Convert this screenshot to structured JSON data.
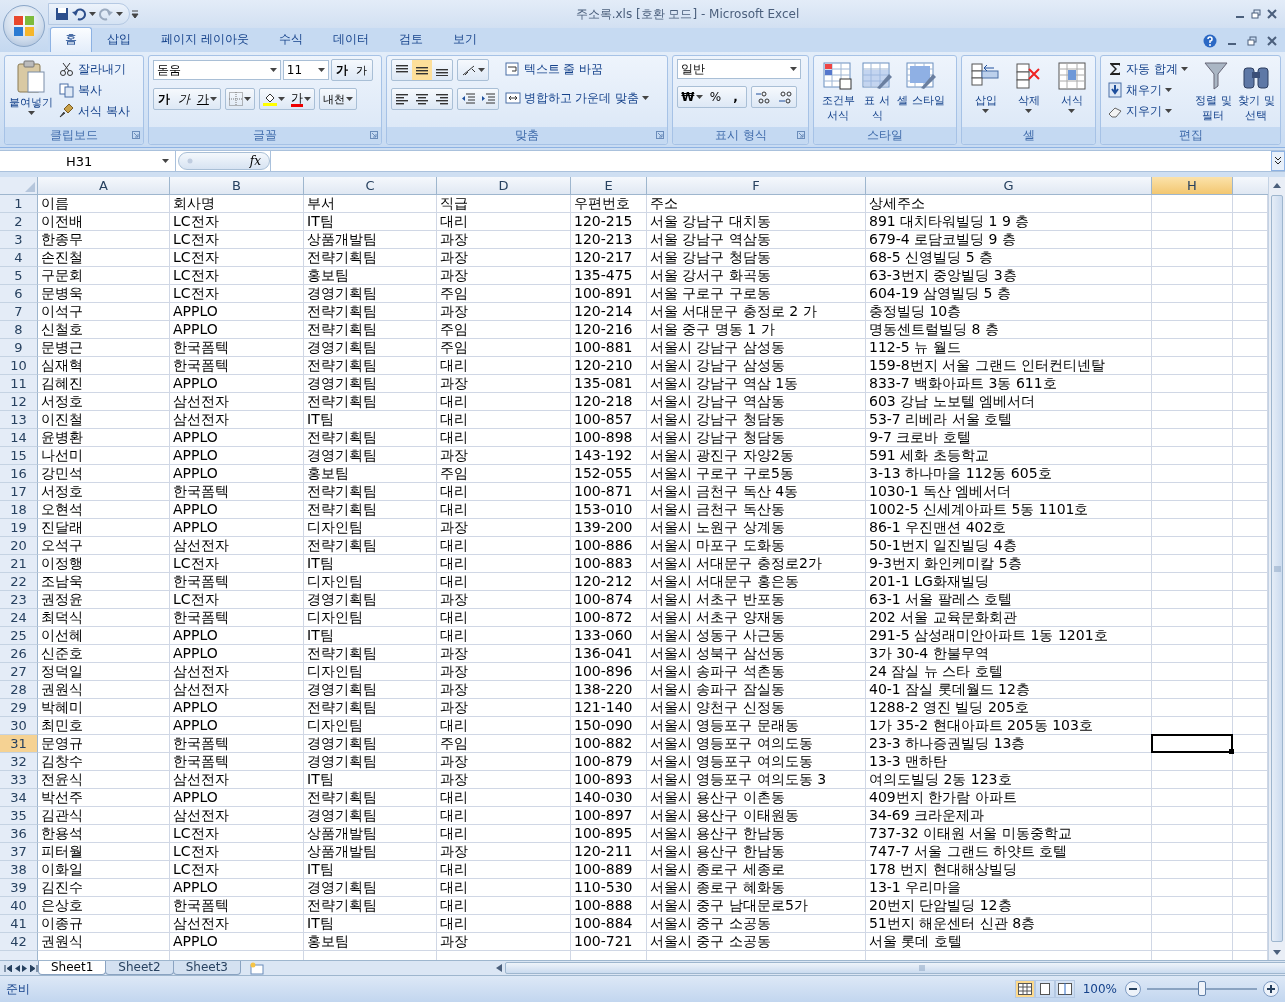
{
  "window": {
    "title": "주소록.xls  [호환 모드] - Microsoft Excel"
  },
  "ribbon": {
    "tabs": [
      {
        "label": "홈",
        "selected": true
      },
      {
        "label": "삽입",
        "selected": false
      },
      {
        "label": "페이지 레이아웃",
        "selected": false
      },
      {
        "label": "수식",
        "selected": false
      },
      {
        "label": "데이터",
        "selected": false
      },
      {
        "label": "검토",
        "selected": false
      },
      {
        "label": "보기",
        "selected": false
      }
    ],
    "groups": [
      {
        "kind": "clipboard",
        "label": "클립보드",
        "paste": "붙여넣기",
        "commands": [
          "잘라내기",
          "복사",
          "서식 복사"
        ]
      },
      {
        "kind": "font",
        "label": "글꼴",
        "font": "돋움",
        "size": "11",
        "grow": "가",
        "shrink": "가",
        "bold": "가",
        "italic": "가",
        "underline": "가",
        "font_color": "가",
        "phonetic": "내천"
      },
      {
        "kind": "alignment",
        "label": "맞춤",
        "wrap": "텍스트 줄 바꿈",
        "merge": "병합하고 가운데 맞춤"
      },
      {
        "kind": "number",
        "label": "표시 형식",
        "format": "일반",
        "currency": "₩",
        "percent": "%",
        "comma": ","
      },
      {
        "kind": "styles",
        "label": "스타일",
        "commands": [
          "조건부 서식",
          "표 서식",
          "셀 스타일"
        ]
      },
      {
        "kind": "cells",
        "label": "셀",
        "commands": [
          "삽입",
          "삭제",
          "서식"
        ]
      },
      {
        "kind": "editing",
        "label": "편집",
        "commands": [
          "자동 합계",
          "채우기",
          "지우기"
        ],
        "large": [
          "정렬 및 필터",
          "찾기 및 선택"
        ]
      }
    ]
  },
  "formula_bar": {
    "name_box": "H31",
    "fx": "fx"
  },
  "sheet": {
    "columns": [
      {
        "label": "A",
        "selected": false
      },
      {
        "label": "B",
        "selected": false
      },
      {
        "label": "C",
        "selected": false
      },
      {
        "label": "D",
        "selected": false
      },
      {
        "label": "E",
        "selected": false
      },
      {
        "label": "F",
        "selected": false
      },
      {
        "label": "G",
        "selected": false
      },
      {
        "label": "H",
        "selected": true
      }
    ],
    "rows": [
      {
        "number": "1",
        "selected": false,
        "cells": [
          "이름",
          "회사명",
          "부서",
          "직급",
          "우편번호",
          "주소",
          "상세주소"
        ]
      },
      {
        "number": "2",
        "selected": false,
        "cells": [
          "이전배",
          "LC전자",
          "IT팀",
          "대리",
          "120-215",
          "서울 강남구 대치동",
          "891 대치타워빌딩 1 9 층"
        ]
      },
      {
        "number": "3",
        "selected": false,
        "cells": [
          "한종무",
          "LC전자",
          "상품개발팀",
          "과장",
          "120-213",
          "서울 강남구 역삼동",
          "679-4 로담코빌딩 9 층"
        ]
      },
      {
        "number": "4",
        "selected": false,
        "cells": [
          "손진철",
          "LC전자",
          "전략기획팀",
          "과장",
          "120-217",
          "서울 강남구 청담동",
          "68-5 신영빌딩 5 층"
        ]
      },
      {
        "number": "5",
        "selected": false,
        "cells": [
          "구문회",
          "LC전자",
          "홍보팀",
          "과장",
          "135-475",
          "서울 강서구 화곡동",
          "63-3번지 중앙빌딩 3층"
        ]
      },
      {
        "number": "6",
        "selected": false,
        "cells": [
          "문병욱",
          "LC전자",
          "경영기획팀",
          "주임",
          "100-891",
          "서울 구로구 구로동",
          "604-19 삼영빌딩 5 층"
        ]
      },
      {
        "number": "7",
        "selected": false,
        "cells": [
          "이석구",
          "APPLO",
          "전략기획팀",
          "과장",
          "120-214",
          "서울 서대문구 충정로 2 가",
          "충정빌딩 10층"
        ]
      },
      {
        "number": "8",
        "selected": false,
        "cells": [
          "신철호",
          "APPLO",
          "전략기획팀",
          "주임",
          "120-216",
          "서울 중구 명동 1 가",
          "명동센트럴빌딩 8 층"
        ]
      },
      {
        "number": "9",
        "selected": false,
        "cells": [
          "문병근",
          "한국폼텍",
          "경영기획팀",
          "주임",
          "100-881",
          "서울시 강남구 삼성동",
          "112-5 뉴 월드"
        ]
      },
      {
        "number": "10",
        "selected": false,
        "cells": [
          "심재혁",
          "한국폼텍",
          "전략기획팀",
          "대리",
          "120-210",
          "서울시 강남구 삼성동",
          "159-8번지 서울 그랜드 인터컨티넨탈"
        ]
      },
      {
        "number": "11",
        "selected": false,
        "cells": [
          "김혜진",
          "APPLO",
          "경영기획팀",
          "과장",
          "135-081",
          "서울시 강남구 역삼 1동",
          "833-7 백화아파트 3동 611호"
        ]
      },
      {
        "number": "12",
        "selected": false,
        "cells": [
          "서정호",
          "삼선전자",
          "전략기획팀",
          "대리",
          "120-218",
          "서울시 강남구 역삼동",
          "603 강남 노보텔 엠베서더"
        ]
      },
      {
        "number": "13",
        "selected": false,
        "cells": [
          "이진철",
          "삼선전자",
          "IT팀",
          "대리",
          "100-857",
          "서울시 강남구 청담동",
          "53-7 리베라 서울 호텔"
        ]
      },
      {
        "number": "14",
        "selected": false,
        "cells": [
          "윤병환",
          "APPLO",
          "전략기획팀",
          "대리",
          "100-898",
          "서울시 강남구 청담동",
          "9-7 크로바 호텔"
        ]
      },
      {
        "number": "15",
        "selected": false,
        "cells": [
          "나선미",
          "APPLO",
          "경영기획팀",
          "과장",
          "143-192",
          "서울시 광진구 자양2동",
          "591 세화 초등학교"
        ]
      },
      {
        "number": "16",
        "selected": false,
        "cells": [
          "강민석",
          "APPLO",
          "홍보팀",
          "주임",
          "152-055",
          "서울시 구로구 구로5동",
          "3-13 하나마을 112동 605호"
        ]
      },
      {
        "number": "17",
        "selected": false,
        "cells": [
          "서정호",
          "한국폼텍",
          "전략기획팀",
          "대리",
          "100-871",
          "서울시 금천구 독산 4동",
          "1030-1 독산 엠베서더"
        ]
      },
      {
        "number": "18",
        "selected": false,
        "cells": [
          "오현석",
          "APPLO",
          "전략기획팀",
          "대리",
          "153-010",
          "서울시 금천구 독산동",
          "1002-5 신세계아파트 5동 1101호"
        ]
      },
      {
        "number": "19",
        "selected": false,
        "cells": [
          "진달래",
          "APPLO",
          "디자인팀",
          "과장",
          "139-200",
          "서울시 노원구 상계동",
          "86-1 우진맨션 402호"
        ]
      },
      {
        "number": "20",
        "selected": false,
        "cells": [
          "오석구",
          "삼선전자",
          "전략기획팀",
          "대리",
          "100-886",
          "서울시 마포구 도화동",
          "50-1번지 일진빌딩 4층"
        ]
      },
      {
        "number": "21",
        "selected": false,
        "cells": [
          "이정행",
          "LC전자",
          "IT팀",
          "대리",
          "100-883",
          "서울시 서대문구 충정로2가",
          "9-3번지 화인케미칼 5층"
        ]
      },
      {
        "number": "22",
        "selected": false,
        "cells": [
          "조남욱",
          "한국폼텍",
          "디자인팀",
          "대리",
          "120-212",
          "서울시 서대문구 홍은동",
          "201-1 LG화재빌딩"
        ]
      },
      {
        "number": "23",
        "selected": false,
        "cells": [
          "권정윤",
          "LC전자",
          "경영기획팀",
          "과장",
          "100-874",
          "서울시 서초구 반포동",
          "63-1 서울 팔레스 호텔"
        ]
      },
      {
        "number": "24",
        "selected": false,
        "cells": [
          "최덕식",
          "한국폼텍",
          "디자인팀",
          "대리",
          "100-872",
          "서울시 서초구 양재동",
          "202 서울 교육문화회관"
        ]
      },
      {
        "number": "25",
        "selected": false,
        "cells": [
          "이선혜",
          "APPLO",
          "IT팀",
          "대리",
          "133-060",
          "서울시 성동구 사근동",
          "291-5 삼성래미안아파트 1동 1201호"
        ]
      },
      {
        "number": "26",
        "selected": false,
        "cells": [
          "신준호",
          "APPLO",
          "전략기획팀",
          "과장",
          "136-041",
          "서울시 성북구 삼선동",
          "3가 30-4 한불무역"
        ]
      },
      {
        "number": "27",
        "selected": false,
        "cells": [
          "정덕일",
          "삼선전자",
          "디자인팀",
          "과장",
          "100-896",
          "서울시 송파구 석촌동",
          "24 잠실 뉴 스타 호텔"
        ]
      },
      {
        "number": "28",
        "selected": false,
        "cells": [
          "권원식",
          "삼선전자",
          "경영기획팀",
          "과장",
          "138-220",
          "서울시 송파구 잠실동",
          "40-1 잠실 롯데월드 12층"
        ]
      },
      {
        "number": "29",
        "selected": false,
        "cells": [
          "박혜미",
          "APPLO",
          "전략기획팀",
          "과장",
          "121-140",
          "서울시 양천구 신정동",
          "1288-2 영진 빌딩 205호"
        ]
      },
      {
        "number": "30",
        "selected": false,
        "cells": [
          "최민호",
          "APPLO",
          "디자인팀",
          "대리",
          "150-090",
          "서울시 영등포구 문래동",
          "1가 35-2 현대아파트 205동 103호"
        ]
      },
      {
        "number": "31",
        "selected": true,
        "cells": [
          "문영규",
          "한국폼텍",
          "경영기획팀",
          "주임",
          "100-882",
          "서울시 영등포구 여의도동",
          "23-3 하나증권빌딩 13층"
        ]
      },
      {
        "number": "32",
        "selected": false,
        "cells": [
          "김창수",
          "한국폼텍",
          "경영기획팀",
          "과장",
          "100-879",
          "서울시 영등포구 여의도동",
          "13-3 맨하탄"
        ]
      },
      {
        "number": "33",
        "selected": false,
        "cells": [
          "전윤식",
          "삼선전자",
          "IT팀",
          "과장",
          "100-893",
          "서울시 영등포구 여의도동 3",
          "여의도빌딩 2동 123호"
        ]
      },
      {
        "number": "34",
        "selected": false,
        "cells": [
          "박선주",
          "APPLO",
          "전략기획팀",
          "대리",
          "140-030",
          "서울시 용산구 이촌동",
          "409번지 한가람 아파트"
        ]
      },
      {
        "number": "35",
        "selected": false,
        "cells": [
          "김관식",
          "삼선전자",
          "경영기획팀",
          "대리",
          "100-897",
          "서울시 용산구 이태원동",
          "34-69 크라운제과"
        ]
      },
      {
        "number": "36",
        "selected": false,
        "cells": [
          "한용석",
          "LC전자",
          "상품개발팀",
          "대리",
          "100-895",
          "서울시 용산구 한남동",
          "737-32 이태원 서울 미동중학교"
        ]
      },
      {
        "number": "37",
        "selected": false,
        "cells": [
          "피터월",
          "LC전자",
          "상품개발팀",
          "과장",
          "120-211",
          "서울시 용산구 한남동",
          "747-7 서울 그랜드 하얏트 호텔"
        ]
      },
      {
        "number": "38",
        "selected": false,
        "cells": [
          "이화일",
          "LC전자",
          "IT팀",
          "대리",
          "100-889",
          "서울시 종로구 세종로",
          "178 번지 현대해상빌딩"
        ]
      },
      {
        "number": "39",
        "selected": false,
        "cells": [
          "김진수",
          "APPLO",
          "경영기획팀",
          "대리",
          "110-530",
          "서울시 종로구 혜화동",
          "13-1 우리마을"
        ]
      },
      {
        "number": "40",
        "selected": false,
        "cells": [
          "은상호",
          "한국폼텍",
          "전략기획팀",
          "대리",
          "100-888",
          "서울시 중구 남대문로5가",
          "20번지 단암빌딩 12층"
        ]
      },
      {
        "number": "41",
        "selected": false,
        "cells": [
          "이종규",
          "삼선전자",
          "IT팀",
          "대리",
          "100-884",
          "서울시 중구 소공동",
          "51번지 해운센터 신관 8층"
        ]
      },
      {
        "number": "42",
        "selected": false,
        "cells": [
          "권원식",
          "APPLO",
          "홍보팀",
          "과장",
          "100-721",
          "서울시 중구 소공동",
          "서울 롯데 호텔"
        ]
      }
    ]
  },
  "sheet_tabs": [
    {
      "label": "Sheet1",
      "selected": true
    },
    {
      "label": "Sheet2",
      "selected": false
    },
    {
      "label": "Sheet3",
      "selected": false
    }
  ],
  "status_bar": {
    "status": "준비",
    "zoom": "100%",
    "zoom_slider": {
      "level": 0.5
    }
  }
}
